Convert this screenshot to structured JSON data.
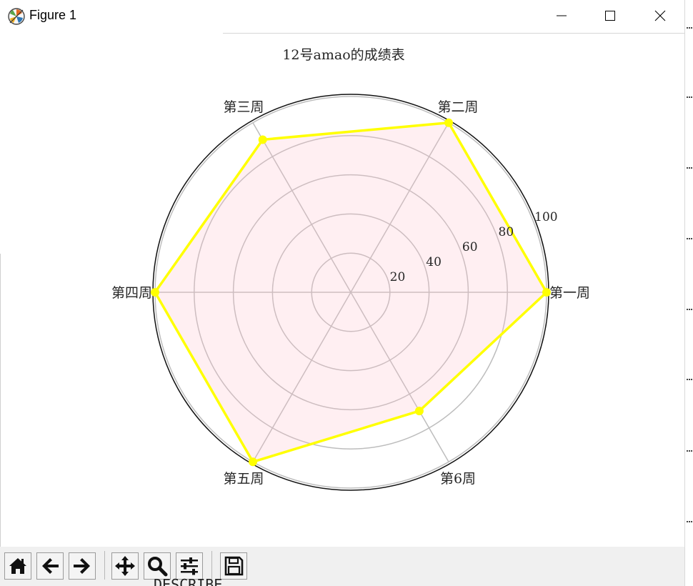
{
  "window": {
    "title": "Figure 1",
    "icons": {
      "app": "matplotlib-logo-icon",
      "minimize": "minimize-icon",
      "maximize": "maximize-icon",
      "close": "close-icon"
    }
  },
  "chart_data": {
    "type": "radar",
    "title": "12号amao的成绩表",
    "categories": [
      "第一周",
      "第二周",
      "第三周",
      "第四周",
      "第五周",
      "第6周"
    ],
    "values": [
      100,
      100,
      90,
      100,
      100,
      70
    ],
    "rlim": [
      0,
      100
    ],
    "radial_ticks": [
      20,
      40,
      60,
      80,
      100
    ],
    "grid": true,
    "line_color": "#ffff00",
    "fill_color": "#ffc0cb",
    "fill_alpha": 0.25
  },
  "toolbar": {
    "buttons": [
      {
        "name": "home-button",
        "icon": "home-icon"
      },
      {
        "name": "back-button",
        "icon": "arrow-left-icon"
      },
      {
        "name": "forward-button",
        "icon": "arrow-right-icon"
      },
      {
        "name": "pan-button",
        "icon": "move-icon"
      },
      {
        "name": "zoom-button",
        "icon": "magnifier-icon"
      },
      {
        "name": "configure-subplots-button",
        "icon": "sliders-icon"
      },
      {
        "name": "save-button",
        "icon": "floppy-disk-icon"
      }
    ]
  },
  "background_peek_text": "DESCRIBE ... ..."
}
